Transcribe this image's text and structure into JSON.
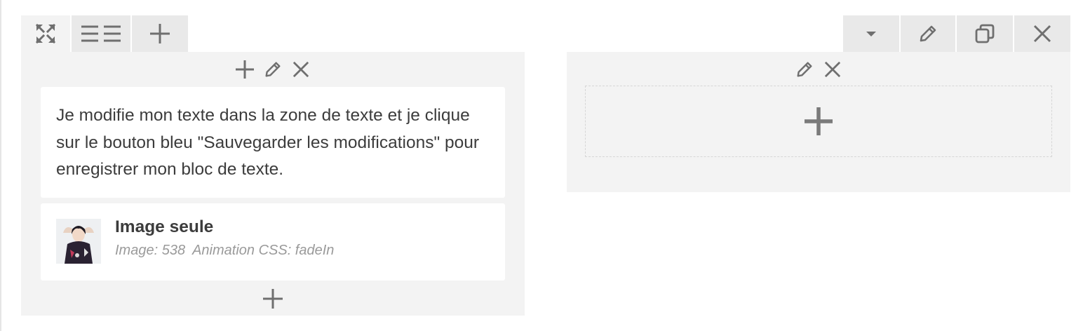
{
  "row_toolbar": {
    "left_icons": [
      "expand-icon",
      "columns-icon",
      "plus-icon"
    ],
    "right_icons": [
      "caret-down-icon",
      "pencil-icon",
      "duplicate-icon",
      "close-icon"
    ]
  },
  "column_left": {
    "tool_icons": [
      "plus-icon",
      "pencil-icon",
      "close-icon"
    ],
    "text_block": {
      "content": "Je modifie mon texte dans la zone de texte et je clique sur le bouton bleu \"Sauvegarder les modifications\" pour enregistrer mon bloc de texte."
    },
    "image_block": {
      "title": "Image seule",
      "image_meta": "Image: 538",
      "animation_meta": "Animation CSS: fadeIn"
    },
    "add_icon": "plus-icon"
  },
  "column_right": {
    "tool_icons": [
      "pencil-icon",
      "close-icon"
    ],
    "empty_add_icon": "plus-icon"
  },
  "colors": {
    "icon": "#6f6f6f",
    "tab_bg": "#e9e9e9",
    "column_bg": "#f3f3f3",
    "card_bg": "#ffffff",
    "text": "#3c3c3c",
    "meta_text": "#9a9a9a"
  }
}
